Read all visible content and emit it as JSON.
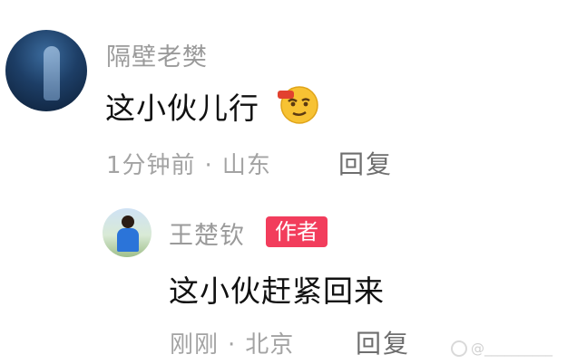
{
  "comment": {
    "avatar_icon": "user-avatar-night-icon",
    "username": "隔壁老樊",
    "text": "这小伙儿行",
    "emoji_icon": "smirk-wink-emoji-icon",
    "time": "1分钟前",
    "location": "山东",
    "reply_label": "回复"
  },
  "reply": {
    "avatar_icon": "user-avatar-photo-icon",
    "username": "王楚钦",
    "badge": "作者",
    "text": "这小伙赶紧回来",
    "time": "刚刚",
    "location": "北京",
    "reply_label": "回复"
  },
  "watermark": {
    "text": "@__________"
  },
  "colors": {
    "username": "#9a9a9a",
    "content": "#111111",
    "meta": "#a3a3a3",
    "badge_bg": "#f23d5c"
  }
}
